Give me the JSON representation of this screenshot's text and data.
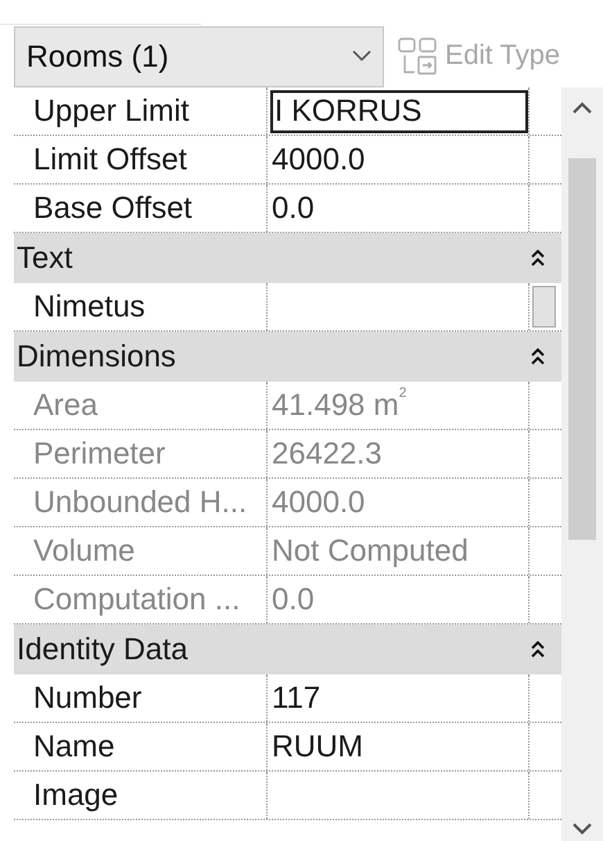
{
  "type_selector": {
    "label": "Rooms (1)"
  },
  "edit_type": {
    "label": "Edit Type",
    "disabled": true
  },
  "items": [
    {
      "kind": "row",
      "label": "Upper Limit",
      "value": "I KORRUS",
      "disabled": false,
      "editing": true,
      "button": false
    },
    {
      "kind": "row",
      "label": "Limit Offset",
      "value": "4000.0",
      "disabled": false,
      "editing": false,
      "button": false
    },
    {
      "kind": "row",
      "label": "Base Offset",
      "value": "0.0",
      "disabled": false,
      "editing": false,
      "button": false
    },
    {
      "kind": "header",
      "label": "Text",
      "expanded": true
    },
    {
      "kind": "row",
      "label": "Nimetus",
      "disabled": false,
      "editing": false,
      "button": true
    },
    {
      "kind": "header",
      "label": "Dimensions",
      "expanded": true
    },
    {
      "kind": "row",
      "label": "Area",
      "value": "41.498 m$^{2}$",
      "disabled": true,
      "editing": false,
      "button": false
    },
    {
      "kind": "row",
      "label": "Perimeter",
      "value": "26422.3",
      "disabled": true,
      "editing": false,
      "button": false
    },
    {
      "kind": "row",
      "label": "Unbounded H...",
      "value": "4000.0",
      "disabled": true,
      "editing": false,
      "button": false
    },
    {
      "kind": "row",
      "label": "Volume",
      "value": "Not Computed",
      "disabled": true,
      "editing": false,
      "button": false
    },
    {
      "kind": "row",
      "label": "Computation ...",
      "value": "0.0",
      "disabled": true,
      "editing": false,
      "button": false
    },
    {
      "kind": "header",
      "label": "Identity Data",
      "expanded": true
    },
    {
      "kind": "row",
      "label": "Number",
      "value": "117",
      "disabled": false,
      "editing": false,
      "button": false
    },
    {
      "kind": "row",
      "label": "Name",
      "value": "RUUM",
      "disabled": false,
      "editing": false,
      "button": false
    },
    {
      "kind": "row",
      "label": "Image",
      "disabled": false,
      "editing": false,
      "button": false
    }
  ]
}
